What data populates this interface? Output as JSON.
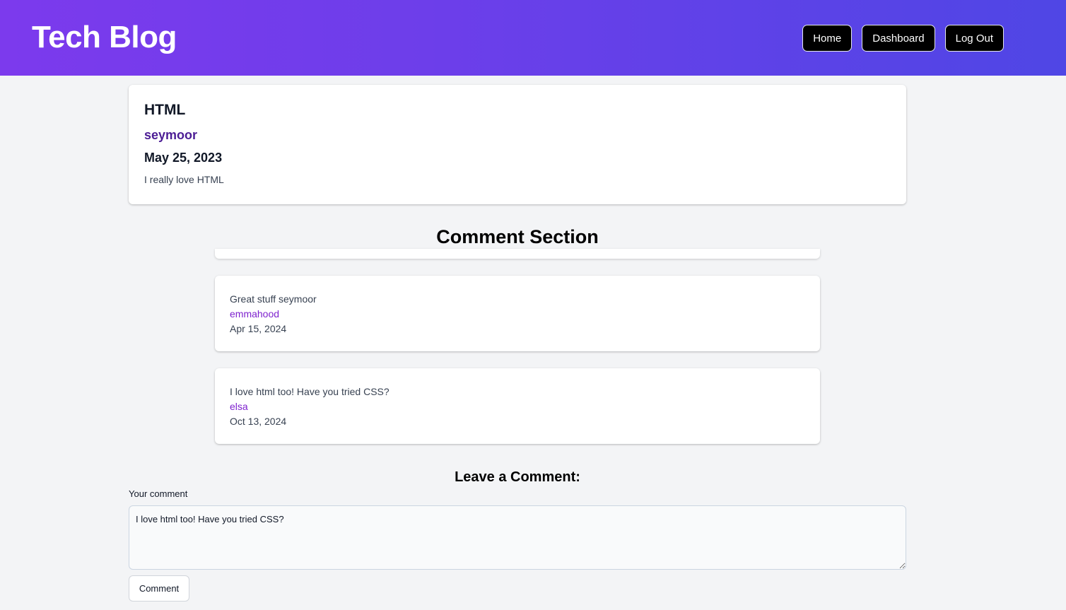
{
  "header": {
    "brand": "Tech Blog",
    "nav": [
      {
        "label": "Home"
      },
      {
        "label": "Dashboard"
      },
      {
        "label": "Log Out"
      }
    ]
  },
  "post": {
    "title": "HTML",
    "author": "seymoor",
    "date": "May 25, 2023",
    "body": "I really love HTML"
  },
  "comments_section": {
    "title": "Comment Section",
    "comments": [
      {
        "text": "Great stuff seymoor",
        "author": "emmahood",
        "date": "Apr 15, 2024"
      },
      {
        "text": "I love html too! Have you tried CSS?",
        "author": "elsa",
        "date": "Oct 13, 2024"
      }
    ]
  },
  "form": {
    "title": "Leave a Comment:",
    "label": "Your comment",
    "value": "I love html too! Have you tried CSS?",
    "submit_label": "Comment"
  },
  "colors": {
    "header_gradient_start": "#7c3aed",
    "header_gradient_end": "#4f46e5",
    "author_post": "#4c1d95",
    "author_comment": "#7e22ce"
  }
}
